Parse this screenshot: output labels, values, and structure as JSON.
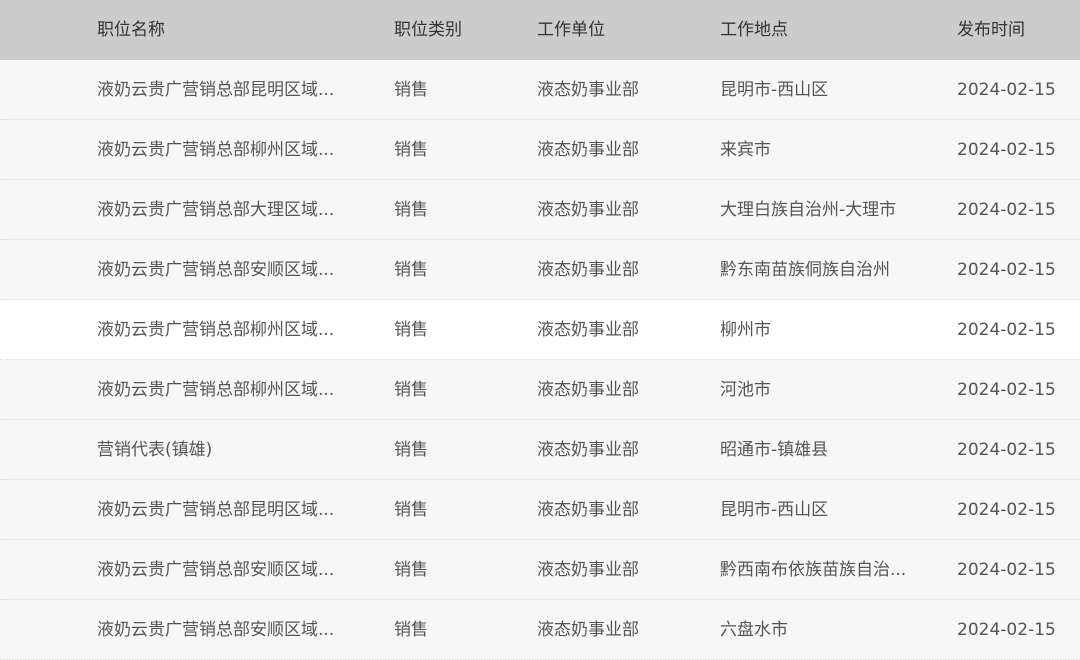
{
  "header": {
    "col_title": "职位名称",
    "col_category": "职位类别",
    "col_unit": "工作单位",
    "col_location": "工作地点",
    "col_date": "发布时间"
  },
  "rows": [
    {
      "title": "液奶云贵广营销总部昆明区域...",
      "category": "销售",
      "unit": "液态奶事业部",
      "location": "昆明市-西山区",
      "date": "2024-02-15"
    },
    {
      "title": "液奶云贵广营销总部柳州区域...",
      "category": "销售",
      "unit": "液态奶事业部",
      "location": "来宾市",
      "date": "2024-02-15"
    },
    {
      "title": "液奶云贵广营销总部大理区域...",
      "category": "销售",
      "unit": "液态奶事业部",
      "location": "大理白族自治州-大理市",
      "date": "2024-02-15"
    },
    {
      "title": "液奶云贵广营销总部安顺区域...",
      "category": "销售",
      "unit": "液态奶事业部",
      "location": "黔东南苗族侗族自治州",
      "date": "2024-02-15"
    },
    {
      "title": "液奶云贵广营销总部柳州区域...",
      "category": "销售",
      "unit": "液态奶事业部",
      "location": "柳州市",
      "date": "2024-02-15"
    },
    {
      "title": "液奶云贵广营销总部柳州区域...",
      "category": "销售",
      "unit": "液态奶事业部",
      "location": "河池市",
      "date": "2024-02-15"
    },
    {
      "title": "营销代表(镇雄)",
      "category": "销售",
      "unit": "液态奶事业部",
      "location": "昭通市-镇雄县",
      "date": "2024-02-15"
    },
    {
      "title": "液奶云贵广营销总部昆明区域...",
      "category": "销售",
      "unit": "液态奶事业部",
      "location": "昆明市-西山区",
      "date": "2024-02-15"
    },
    {
      "title": "液奶云贵广营销总部安顺区域...",
      "category": "销售",
      "unit": "液态奶事业部",
      "location": "黔西南布依族苗族自治...",
      "date": "2024-02-15"
    },
    {
      "title": "液奶云贵广营销总部安顺区域...",
      "category": "销售",
      "unit": "液态奶事业部",
      "location": "六盘水市",
      "date": "2024-02-15"
    }
  ]
}
